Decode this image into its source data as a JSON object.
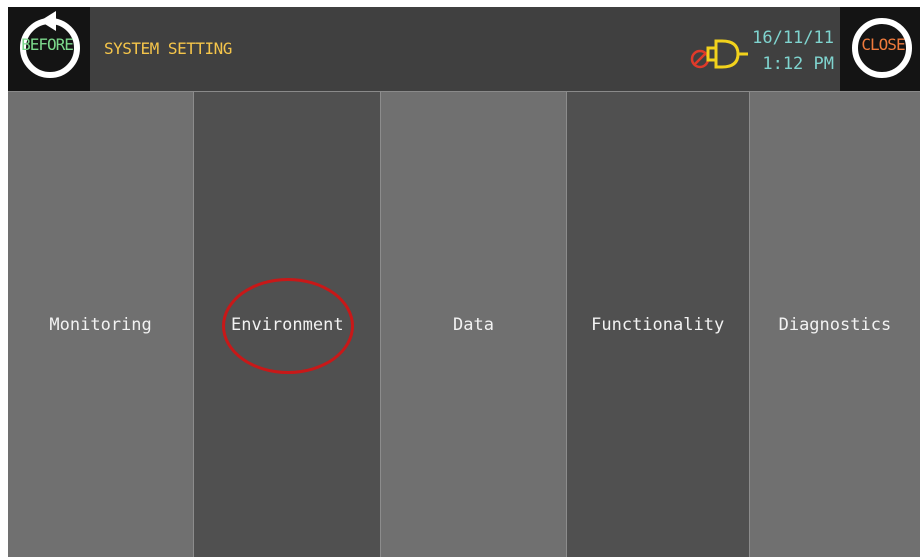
{
  "header": {
    "before_label": "BEFORE",
    "title": "SYSTEM SETTING",
    "date": "16/11/11",
    "time": "1:12 PM",
    "close_label": "CLOSE",
    "buzzer_icon": "buzzer-off-icon",
    "before_icon": "back-arrow-icon"
  },
  "menu": {
    "items": [
      {
        "label": "Monitoring"
      },
      {
        "label": "Environment"
      },
      {
        "label": "Data"
      },
      {
        "label": "Functionality"
      },
      {
        "label": "Diagnostics"
      }
    ]
  },
  "colors": {
    "title": "#f5c54a",
    "datetime": "#7fd4cf",
    "before_text": "#7cd88c",
    "close_text": "#f07a3c",
    "buzzer": "#f2d21c",
    "mute": "#e03a2a",
    "highlight": "#c81818"
  }
}
